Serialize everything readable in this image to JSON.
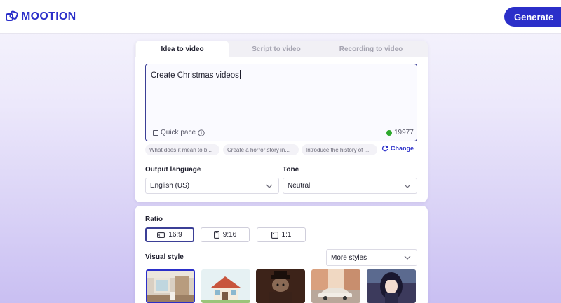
{
  "brand": {
    "name": "MOOTION",
    "color": "#2b2fc9"
  },
  "header": {
    "generate_label": "Generate"
  },
  "tabs": [
    {
      "label": "Idea to video",
      "active": true
    },
    {
      "label": "Script to video",
      "active": false
    },
    {
      "label": "Recording to video",
      "active": false
    }
  ],
  "prompt": {
    "value": "Create Christmas videos",
    "quick_pace_label": "Quick pace",
    "quick_pace_checked": false,
    "credits": "19977"
  },
  "suggestions": [
    "What does it mean to b...",
    "Create a horror story in...",
    "Introduce the history of ..."
  ],
  "change_label": "Change",
  "output_language": {
    "label": "Output language",
    "value": "English (US)"
  },
  "tone": {
    "label": "Tone",
    "value": "Neutral"
  },
  "ratio": {
    "label": "Ratio",
    "options": [
      {
        "label": "16:9",
        "selected": true,
        "icon": "landscape-icon"
      },
      {
        "label": "9:16",
        "selected": false,
        "icon": "portrait-icon"
      },
      {
        "label": "1:1",
        "selected": false,
        "icon": "square-icon"
      }
    ]
  },
  "visual_style": {
    "label": "Visual style",
    "more_styles_label": "More styles",
    "thumbnails": [
      {
        "style": "realistic-interior",
        "selected": true
      },
      {
        "style": "cartoon-house",
        "selected": false
      },
      {
        "style": "noir-animal",
        "selected": false
      },
      {
        "style": "vintage-car",
        "selected": false
      },
      {
        "style": "anime-girl",
        "selected": false
      }
    ]
  }
}
